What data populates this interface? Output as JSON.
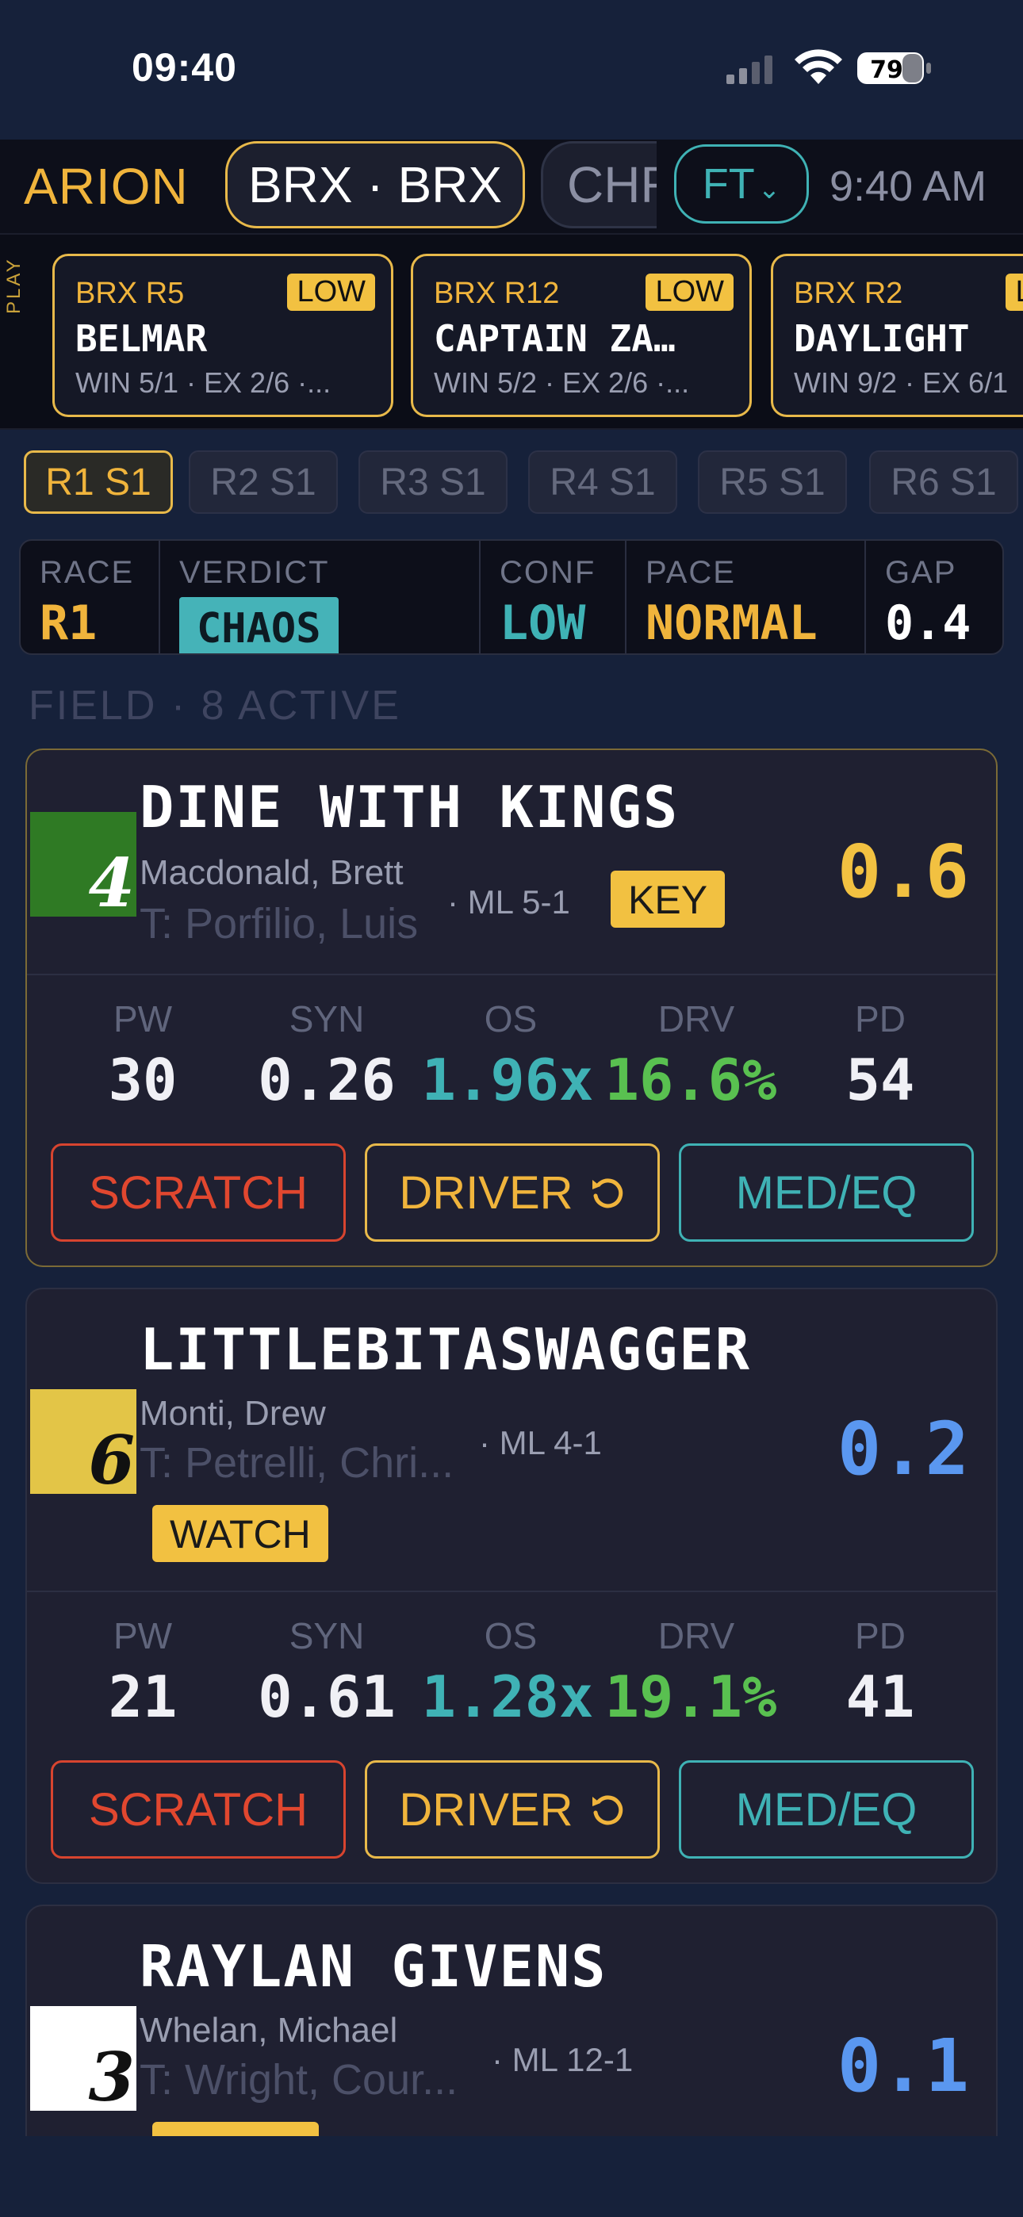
{
  "status_bar": {
    "time": "09:40",
    "battery": "79"
  },
  "nav": {
    "brand": "ARION",
    "tracks": [
      "BRX · BRX",
      "CHR"
    ],
    "mode": "FT",
    "clock": "9:40 AM"
  },
  "picks": {
    "side_label": "PLAY",
    "cards": [
      {
        "track": "BRX R5",
        "confidence": "LOW",
        "horse": "BELMAR",
        "odds": "WIN 5/1 · EX 2/6 ·..."
      },
      {
        "track": "BRX R12",
        "confidence": "LOW",
        "horse": "CAPTAIN ZA…",
        "odds": "WIN 5/2 · EX 2/6 ·..."
      },
      {
        "track": "BRX R2",
        "confidence": "LOW",
        "horse": "DAYLIGHT",
        "odds": "WIN 9/2 · EX 6/1"
      }
    ]
  },
  "race_tabs": [
    "R1 S1",
    "R2 S1",
    "R3 S1",
    "R4 S1",
    "R5 S1",
    "R6 S1"
  ],
  "summary": {
    "race_label": "RACE",
    "race": "R1",
    "verdict_label": "VERDICT",
    "verdict": "CHAOS",
    "conf_label": "CONF",
    "conf": "LOW",
    "pace_label": "PACE",
    "pace": "NORMAL",
    "gap_label": "GAP",
    "gap": "0.4"
  },
  "field_title": "FIELD · 8 ACTIVE",
  "metric_labels": [
    "PW",
    "SYN",
    "OS",
    "DRV",
    "PD"
  ],
  "buttons": {
    "scratch": "SCRATCH",
    "driver": "DRIVER",
    "med": "MED/EQ"
  },
  "horses": [
    {
      "name": "DINE WITH KINGS",
      "number": "4",
      "saddle_color": "#2f7a24",
      "number_color": "#ffffff",
      "jockey": "Macdonald, Brett",
      "trainer": "T: Porfilio, Luis",
      "ml": "· ML 5-1",
      "tag": "KEY",
      "score": "0.6",
      "score_color": "#f2c141",
      "pw": "30",
      "syn": "0.26",
      "os": "1.96x",
      "drv": "16.6%",
      "pd": "54"
    },
    {
      "name": "LITTLEBITASWAGGER",
      "number": "6",
      "saddle_color": "#e3c547",
      "number_color": "#111111",
      "jockey": "Monti, Drew",
      "trainer": "T: Petrelli, Chri...",
      "ml": "· ML 4-1",
      "tag": "WATCH",
      "score": "0.2",
      "score_color": "#5a97f0",
      "pw": "21",
      "syn": "0.61",
      "os": "1.28x",
      "drv": "19.1%",
      "pd": "41"
    },
    {
      "name": "RAYLAN GIVENS",
      "number": "3",
      "saddle_color": "#ffffff",
      "number_color": "#111111",
      "jockey": "Whelan, Michael",
      "trainer": "T: Wright, Cour...",
      "ml": "· ML 12-1",
      "tag": "",
      "score": "0.1",
      "score_color": "#5a97f0"
    }
  ],
  "colors": {
    "accent_gold": "#f0b43c",
    "teal": "#3fb2b5",
    "red": "#e1472f",
    "green": "#59c050",
    "bg": "#16213a"
  }
}
